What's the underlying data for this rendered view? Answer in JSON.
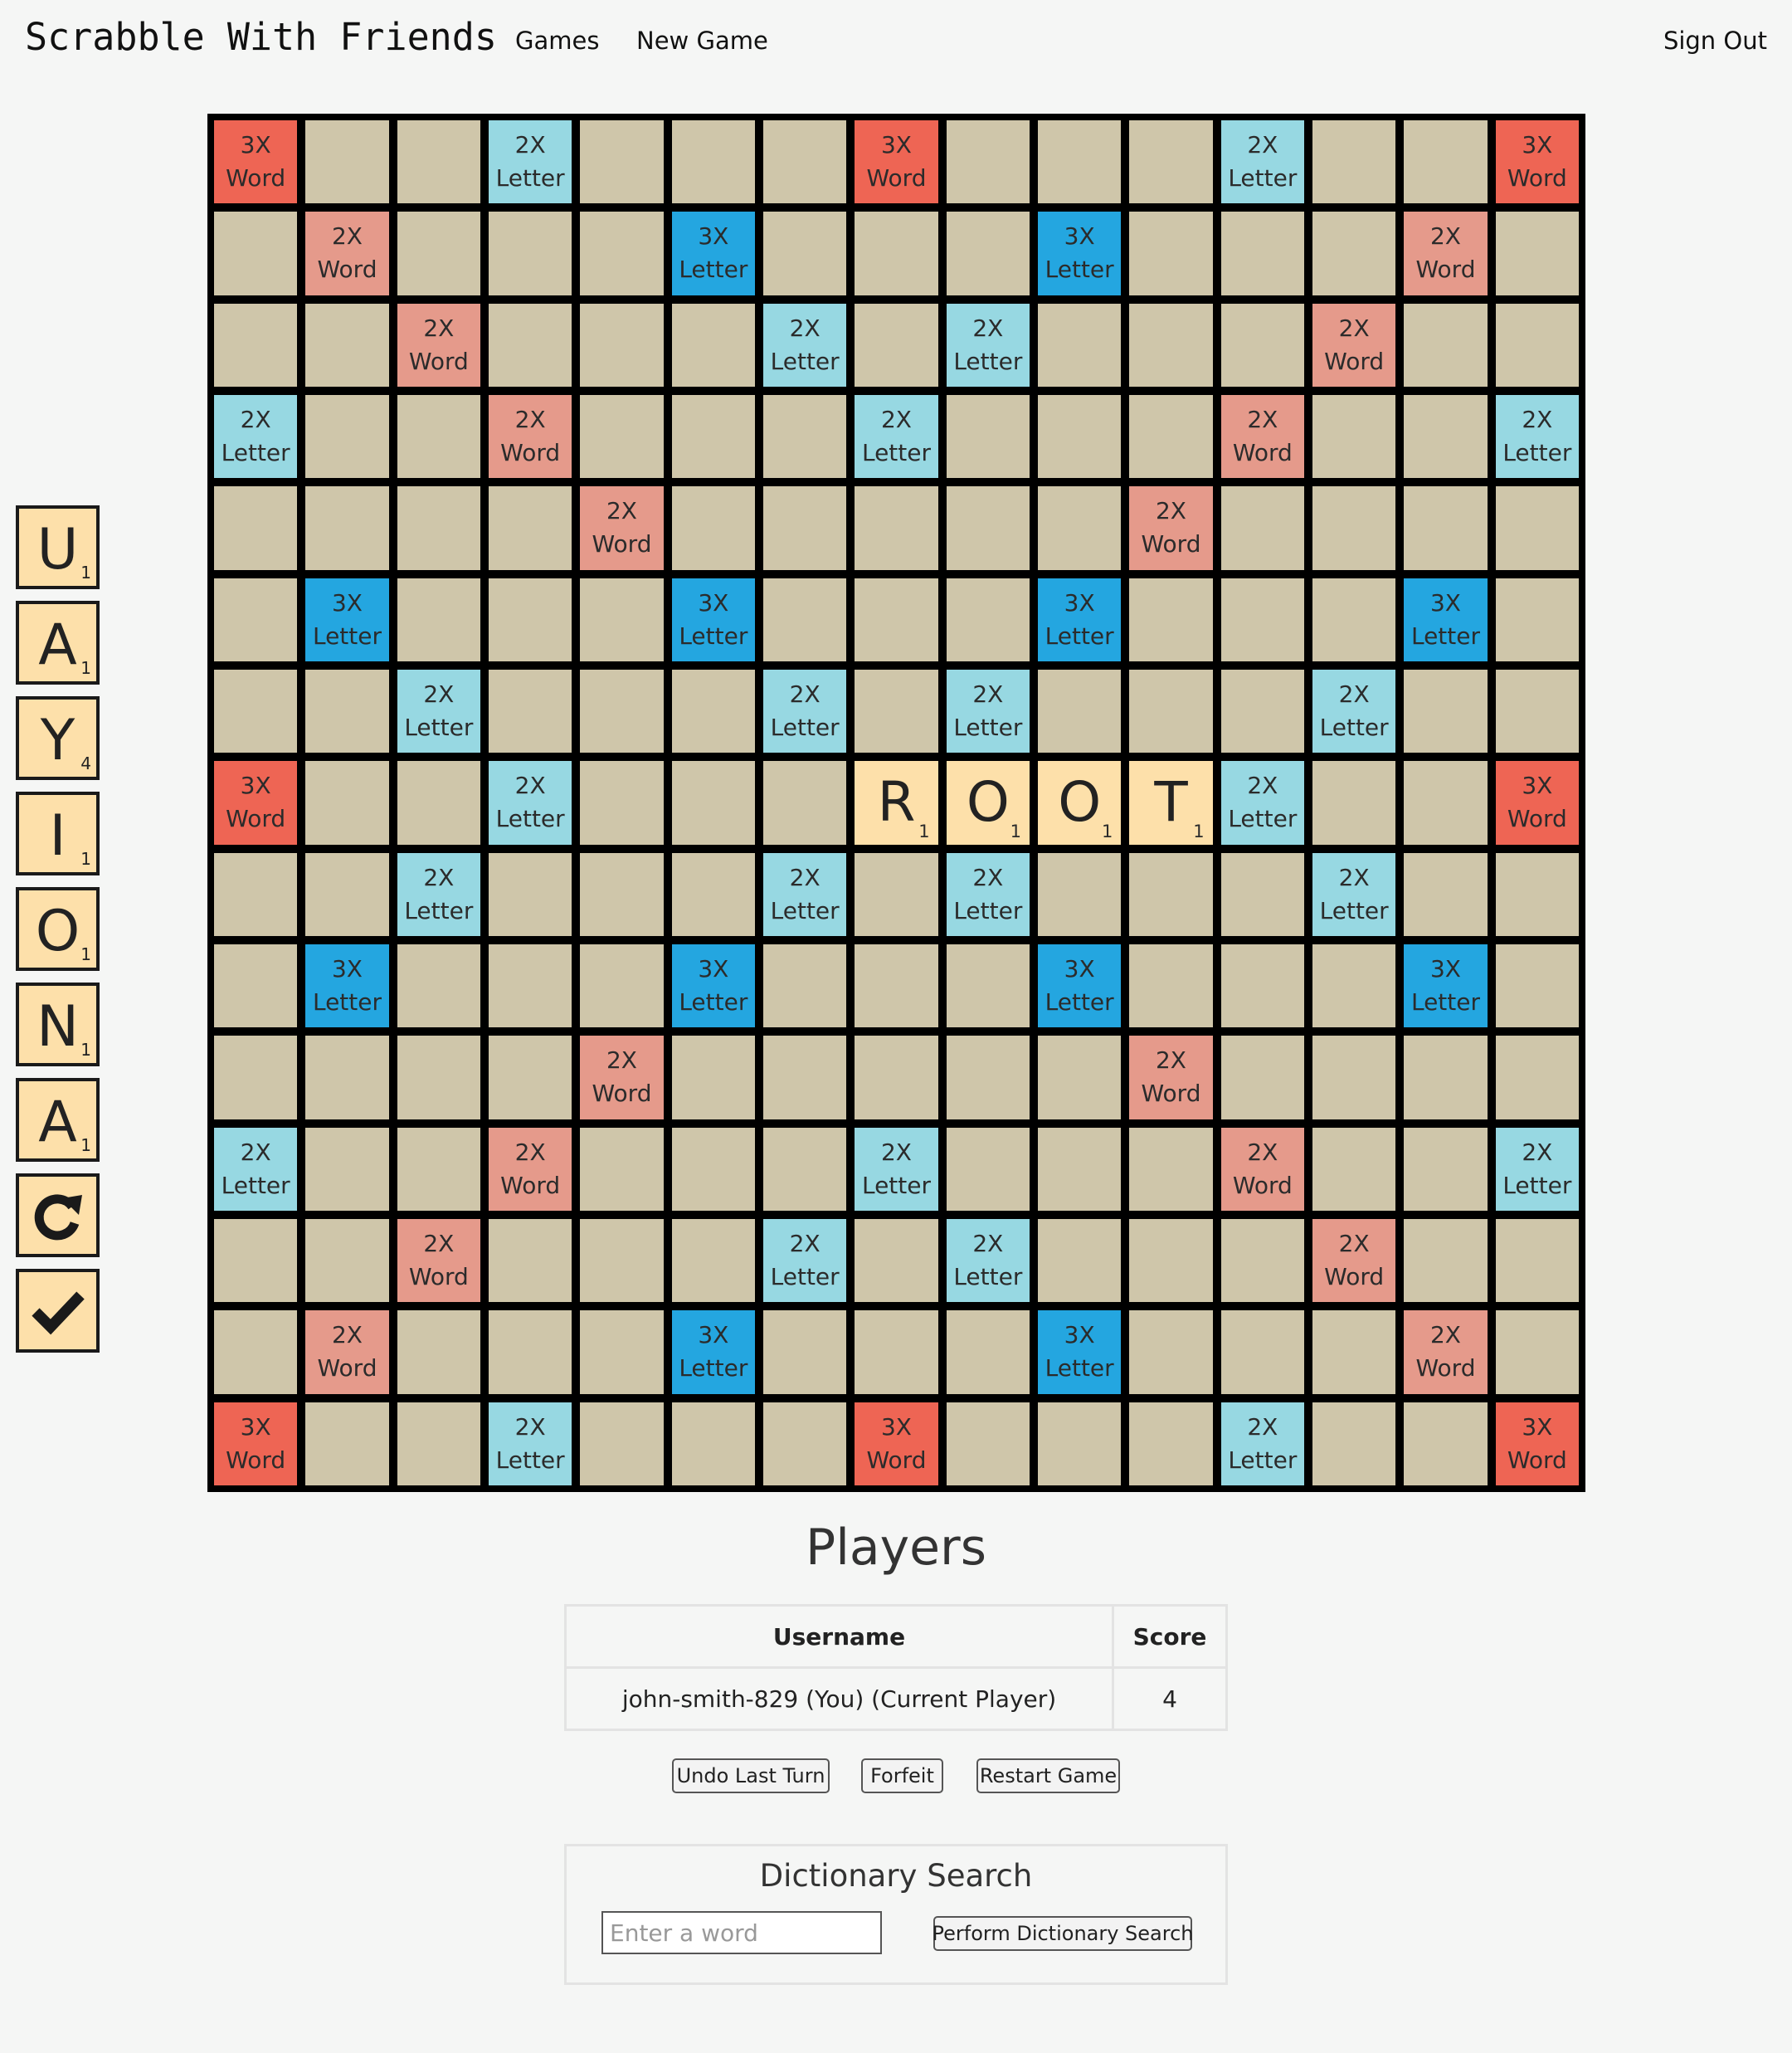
{
  "nav": {
    "brand": "Scrabble With Friends",
    "games": "Games",
    "new_game": "New Game",
    "sign_out": "Sign Out"
  },
  "rack": {
    "tiles": [
      {
        "letter": "U",
        "points": "1"
      },
      {
        "letter": "A",
        "points": "1"
      },
      {
        "letter": "Y",
        "points": "4"
      },
      {
        "letter": "I",
        "points": "1"
      },
      {
        "letter": "O",
        "points": "1"
      },
      {
        "letter": "N",
        "points": "1"
      },
      {
        "letter": "A",
        "points": "1"
      }
    ],
    "shuffle_icon": "redo-icon",
    "submit_icon": "checkmark-icon"
  },
  "board": {
    "size": 15,
    "legend": {
      "TW": [
        "3X",
        "Word"
      ],
      "DW": [
        "2X",
        "Word"
      ],
      "TL": [
        "3X",
        "Letter"
      ],
      "DL": [
        "2X",
        "Letter"
      ]
    },
    "rows": [
      "TW .. .. DL .. .. .. TW .. .. .. DL .. .. TW",
      ".. DW .. .. .. TL .. .. .. TL .. .. .. DW ..",
      ".. .. DW .. .. .. DL .. DL .. .. .. DW .. ..",
      "DL .. .. DW .. .. .. DL .. .. .. DW .. .. DL",
      ".. .. .. .. DW .. .. .. .. .. DW .. .. .. ..",
      ".. TL .. .. .. TL .. .. .. TL .. .. .. TL ..",
      ".. .. DL .. .. .. DL .. DL .. .. .. DL .. ..",
      "TW .. .. DL .. .. .. .. .. .. .. DL .. .. TW",
      ".. .. DL .. .. .. DL .. DL .. .. .. DL .. ..",
      ".. TL .. .. .. TL .. .. .. TL .. .. .. TL ..",
      ".. .. .. .. DW .. .. .. .. .. DW .. .. .. ..",
      "DL .. .. DW .. .. .. DL .. .. .. DW .. .. DL",
      ".. .. DW .. .. .. DL .. DL .. .. .. DW .. ..",
      ".. DW .. .. .. TL .. .. .. TL .. .. .. DW ..",
      "TW .. .. DL .. .. .. TW .. .. .. DL .. .. TW"
    ],
    "placed_tiles": [
      {
        "row": 7,
        "col": 7,
        "letter": "R",
        "points": "1"
      },
      {
        "row": 7,
        "col": 8,
        "letter": "O",
        "points": "1"
      },
      {
        "row": 7,
        "col": 9,
        "letter": "O",
        "points": "1"
      },
      {
        "row": 7,
        "col": 10,
        "letter": "T",
        "points": "1"
      }
    ]
  },
  "players": {
    "title": "Players",
    "headers": {
      "username": "Username",
      "score": "Score"
    },
    "rows": [
      {
        "username": "john-smith-829 (You) (Current Player)",
        "score": "4"
      }
    ]
  },
  "actions": {
    "undo": "Undo Last Turn",
    "forfeit": "Forfeit",
    "restart": "Restart Game"
  },
  "dictionary": {
    "title": "Dictionary Search",
    "placeholder": "Enter a word",
    "value": "",
    "button": "Perform Dictionary Search"
  }
}
